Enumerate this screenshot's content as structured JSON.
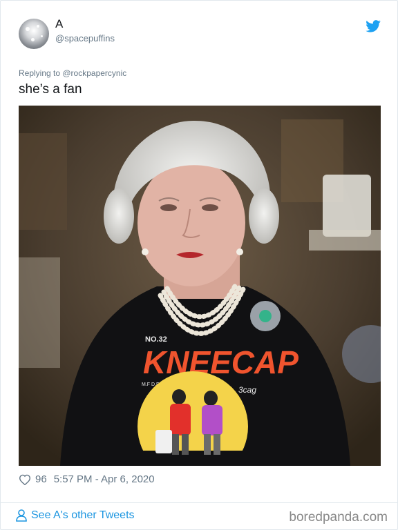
{
  "tweet": {
    "display_name": "A",
    "handle": "@spacepuffins",
    "replying_to": "Replying to @rockpapercynic",
    "text": "she’s a fan",
    "likes": "96",
    "timestamp": "5:57 PM - Apr 6, 2020",
    "see_more": "See A's other Tweets"
  },
  "image": {
    "shirt_number": "NO.32",
    "shirt_title": "KNEECAP",
    "shirt_left": "M.F\nD.F",
    "shirt_right": "3cag"
  },
  "watermark": "boredpanda.com",
  "icons": {
    "brand": "twitter-bird-icon",
    "like": "heart-icon",
    "profile": "person-icon"
  },
  "colors": {
    "link": "#1b95e0",
    "twitter_blue": "#1da1f2",
    "secondary_text": "#657786"
  }
}
